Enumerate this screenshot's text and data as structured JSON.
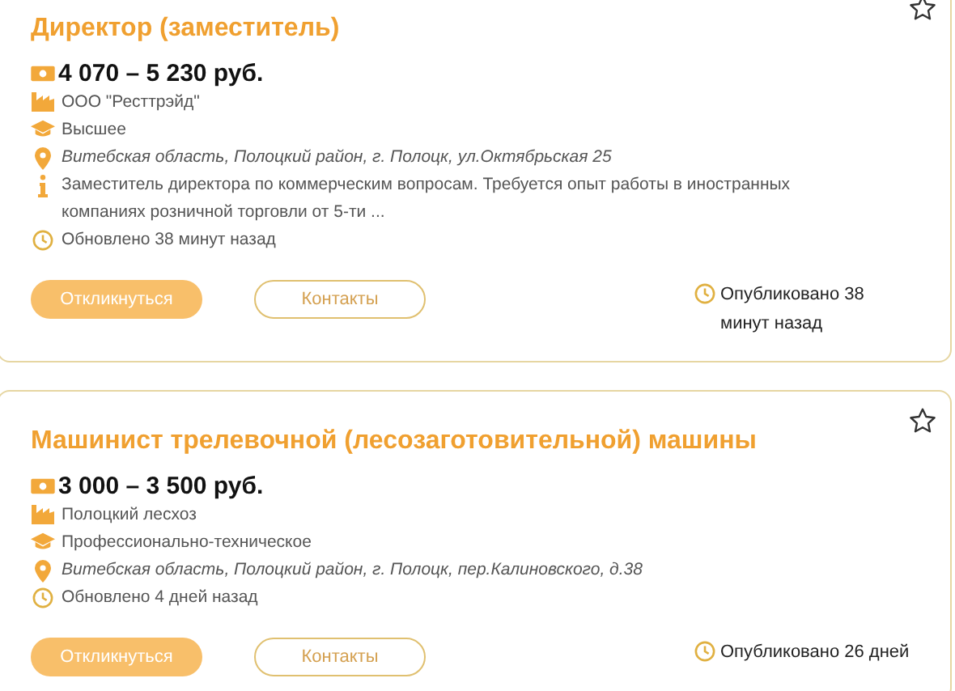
{
  "vacancies": [
    {
      "title": "Директор (заместитель)",
      "salary": "4 070 – 5 230 руб.",
      "details": [
        {
          "kind": "company",
          "text": "ООО \"Ресттрэйд\""
        },
        {
          "kind": "education",
          "text": "Высшее"
        },
        {
          "kind": "address",
          "text": "Витебская область, Полоцкий район, г. Полоцк, ул.Октябрьская 25"
        },
        {
          "kind": "description",
          "text": "Заместитель директора по коммерческим вопросам. Требуется опыт работы в иностранных компаниях розничной торговли от 5-ти ..."
        },
        {
          "kind": "updated",
          "text": "Обновлено 38 минут назад"
        }
      ],
      "apply_button": "Откликнуться",
      "contacts_button": "Контакты",
      "published": "Опубликовано 38 минут назад"
    },
    {
      "title": "Машинист трелевочной (лесозаготовительной) машины",
      "salary": "3 000 – 3 500 руб.",
      "details": [
        {
          "kind": "company",
          "text": "Полоцкий лесхоз"
        },
        {
          "kind": "education",
          "text": "Профессионально-техническое"
        },
        {
          "kind": "address",
          "text": "Витебская область, Полоцкий район, г. Полоцк, пер.Калиновского, д.38"
        },
        {
          "kind": "updated",
          "text": "Обновлено 4 дней назад"
        }
      ],
      "apply_button": "Откликнуться",
      "contacts_button": "Контакты",
      "published": "Опубликовано 26 дней"
    }
  ]
}
